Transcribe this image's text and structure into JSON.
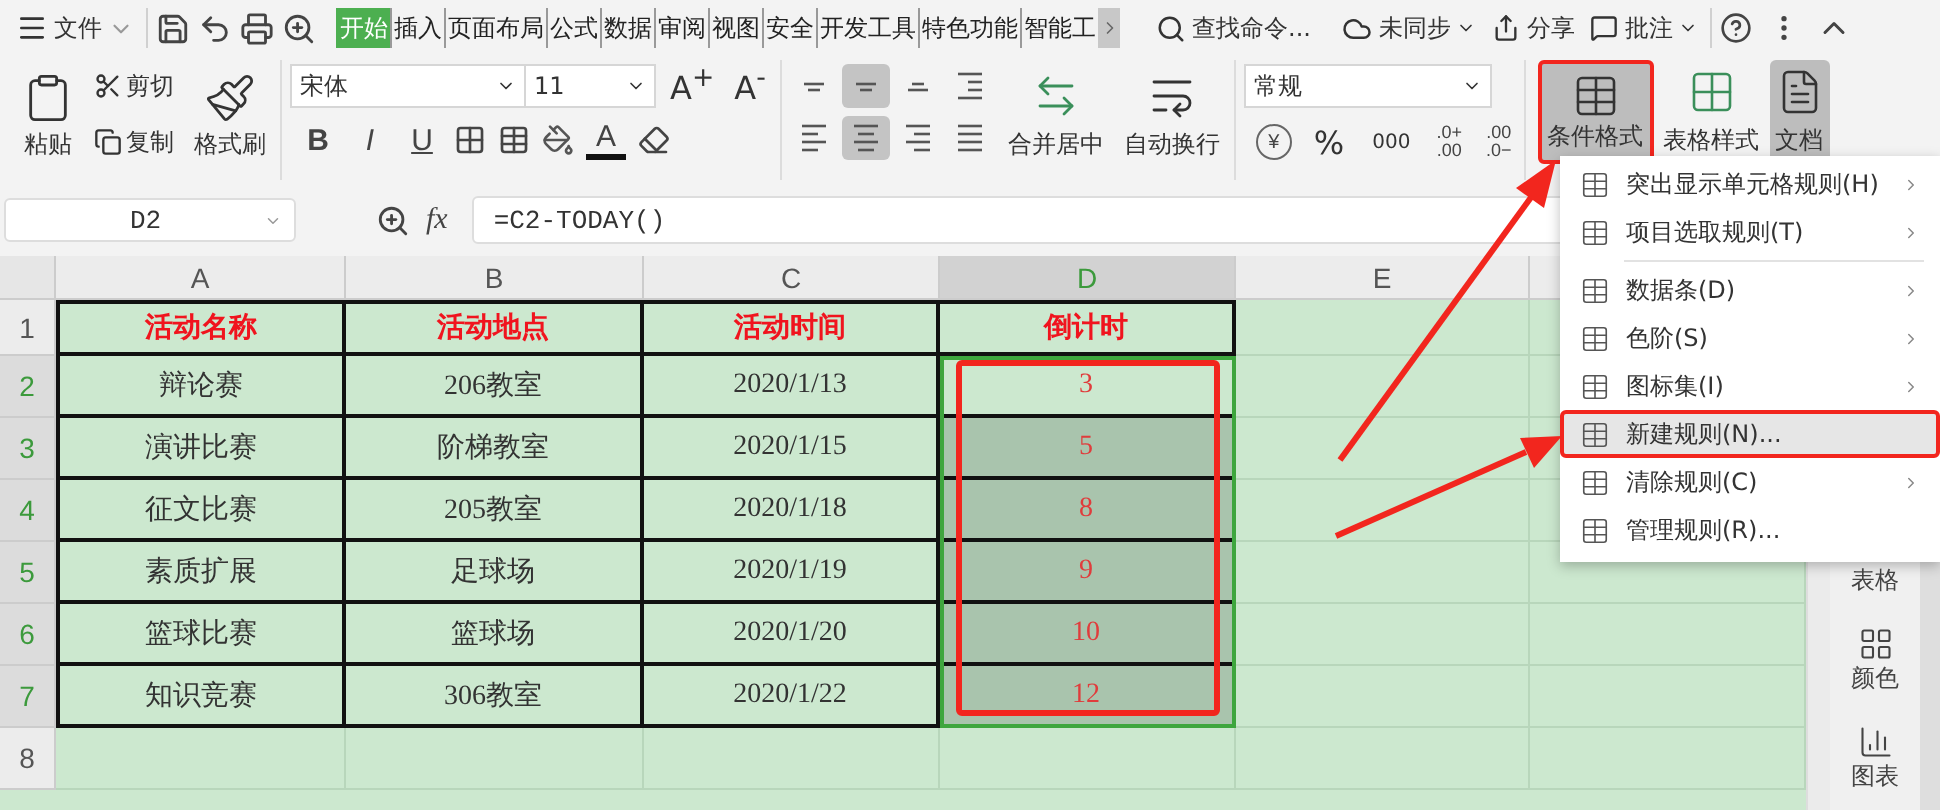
{
  "title_bar": {
    "file_menu": "文件",
    "tabs": [
      {
        "label": "开始",
        "selected": true
      },
      {
        "label": "插入",
        "selected": false
      },
      {
        "label": "页面布局",
        "selected": false
      },
      {
        "label": "公式",
        "selected": false
      },
      {
        "label": "数据",
        "selected": false
      },
      {
        "label": "审阅",
        "selected": false
      },
      {
        "label": "视图",
        "selected": false
      },
      {
        "label": "安全",
        "selected": false
      },
      {
        "label": "开发工具",
        "selected": false
      },
      {
        "label": "特色功能",
        "selected": false
      },
      {
        "label": "智能工",
        "selected": false
      }
    ],
    "search": "查找命令...",
    "sync": "未同步",
    "share": "分享",
    "comment": "批注"
  },
  "ribbon": {
    "paste": "粘贴",
    "cut": "剪切",
    "copy": "复制",
    "format_painter": "格式刷",
    "font_name": "宋体",
    "font_size": "11",
    "grow_font": "A$^{+}$",
    "shrink_font": "A$^{-}$",
    "text_styles": [
      "B",
      "I",
      "U"
    ],
    "font_color": "A",
    "align_buttons": [
      {
        "kind": "top",
        "selected": false
      },
      {
        "kind": "middle",
        "selected": true
      },
      {
        "kind": "bottom",
        "selected": false
      },
      {
        "kind": "indent",
        "selected": false
      },
      {
        "kind": "left",
        "selected": false
      },
      {
        "kind": "center",
        "selected": true
      },
      {
        "kind": "right",
        "selected": false
      },
      {
        "kind": "justify",
        "selected": false
      }
    ],
    "merge": "合并居中",
    "wrap": "自动换行",
    "number_format": "常规",
    "currency": "¥",
    "percent": "%",
    "thousands": "000",
    "increase_decimal": [
      ".0+",
      ".00"
    ],
    "decrease_decimal": [
      ".00",
      ".0−"
    ],
    "conditional_format": {
      "label": "条件格式",
      "selected": true
    },
    "table_style": "表格样式",
    "document": "文档"
  },
  "formula_bar": {
    "cell_ref": "D2",
    "fx": "fx",
    "formula": "=C2-TODAY()"
  },
  "sheet": {
    "columns": [
      {
        "label": "A",
        "selected": false
      },
      {
        "label": "B",
        "selected": false
      },
      {
        "label": "C",
        "selected": false
      },
      {
        "label": "D",
        "selected": true
      },
      {
        "label": "E",
        "selected": false
      }
    ],
    "rows": [
      {
        "number": "1",
        "kind": "header",
        "selected": false,
        "cells": [
          {
            "text": "活动名称",
            "selected": false
          },
          {
            "text": "活动地点",
            "selected": false
          },
          {
            "text": "活动时间",
            "selected": false
          },
          {
            "text": "倒计时",
            "selected": false
          }
        ]
      },
      {
        "number": "2",
        "kind": "data",
        "selected": true,
        "cells": [
          {
            "text": "辩论赛",
            "selected": false
          },
          {
            "text": "206教室",
            "selected": false
          },
          {
            "text": "2020/1/13",
            "selected": false
          },
          {
            "text": "3",
            "selected": false
          }
        ]
      },
      {
        "number": "3",
        "kind": "data",
        "selected": true,
        "cells": [
          {
            "text": "演讲比赛",
            "selected": false
          },
          {
            "text": "阶梯教室",
            "selected": false
          },
          {
            "text": "2020/1/15",
            "selected": false
          },
          {
            "text": "5",
            "selected": true
          }
        ]
      },
      {
        "number": "4",
        "kind": "data",
        "selected": true,
        "cells": [
          {
            "text": "征文比赛",
            "selected": false
          },
          {
            "text": "205教室",
            "selected": false
          },
          {
            "text": "2020/1/18",
            "selected": false
          },
          {
            "text": "8",
            "selected": true
          }
        ]
      },
      {
        "number": "5",
        "kind": "data",
        "selected": true,
        "cells": [
          {
            "text": "素质扩展",
            "selected": false
          },
          {
            "text": "足球场",
            "selected": false
          },
          {
            "text": "2020/1/19",
            "selected": false
          },
          {
            "text": "9",
            "selected": true
          }
        ]
      },
      {
        "number": "6",
        "kind": "data",
        "selected": true,
        "cells": [
          {
            "text": "篮球比赛",
            "selected": false
          },
          {
            "text": "篮球场",
            "selected": false
          },
          {
            "text": "2020/1/20",
            "selected": false
          },
          {
            "text": "10",
            "selected": true
          }
        ]
      },
      {
        "number": "7",
        "kind": "data",
        "selected": true,
        "cells": [
          {
            "text": "知识竞赛",
            "selected": false
          },
          {
            "text": "306教室",
            "selected": false
          },
          {
            "text": "2020/1/22",
            "selected": false
          },
          {
            "text": "12",
            "selected": true
          }
        ]
      },
      {
        "number": "8",
        "selected": false
      }
    ]
  },
  "menu": {
    "items": [
      {
        "label": "突出显示单元格规则(H)",
        "submenu": true,
        "separated": false,
        "selected": false
      },
      {
        "label": "项目选取规则(T)",
        "submenu": true,
        "separated": false,
        "selected": false
      },
      {
        "label": "数据条(D)",
        "submenu": true,
        "separated": true,
        "selected": false
      },
      {
        "label": "色阶(S)",
        "submenu": true,
        "separated": false,
        "selected": false
      },
      {
        "label": "图标集(I)",
        "submenu": true,
        "separated": false,
        "selected": false
      },
      {
        "label": "新建规则(N)...",
        "submenu": false,
        "separated": false,
        "selected": true
      },
      {
        "label": "清除规则(C)",
        "submenu": true,
        "separated": false,
        "selected": false
      },
      {
        "label": "管理规则(R)...",
        "submenu": false,
        "separated": false,
        "selected": false
      }
    ]
  },
  "side_panel": [
    {
      "label": "表格",
      "kind": "table"
    },
    {
      "label": "颜色",
      "kind": "color"
    },
    {
      "label": "图表",
      "kind": "chart"
    }
  ]
}
